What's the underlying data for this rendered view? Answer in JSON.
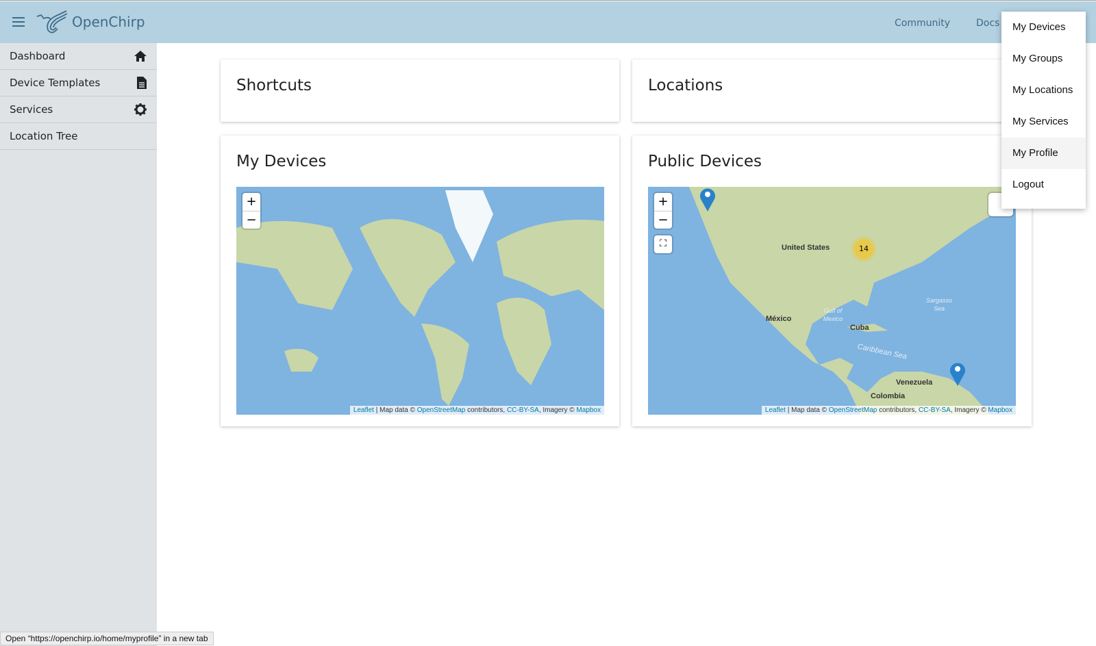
{
  "header": {
    "brand": "OpenChirp",
    "nav": [
      "Community",
      "Docs"
    ]
  },
  "sidebar": {
    "items": [
      {
        "label": "Dashboard",
        "icon": "home-icon"
      },
      {
        "label": "Device Templates",
        "icon": "document-icon"
      },
      {
        "label": "Services",
        "icon": "gear-icon"
      },
      {
        "label": "Location Tree",
        "icon": ""
      }
    ]
  },
  "cards": {
    "shortcuts": "Shortcuts",
    "locations": "Locations",
    "my_devices": "My Devices",
    "public_devices": "Public Devices"
  },
  "map": {
    "zoom_in": "+",
    "zoom_out": "−",
    "attribution": {
      "leaflet": "Leaflet",
      "sep": " | Map data © ",
      "osm": "OpenStreetMap",
      "contrib": " contributors, ",
      "license": "CC-BY-SA",
      "imagery": ", Imagery © ",
      "mapbox": "Mapbox"
    },
    "public_labels": {
      "us": "United States",
      "mexico": "México",
      "cuba": "Cuba",
      "venezuela": "Venezuela",
      "colombia": "Colombia",
      "gulf": "Gulf of Mexico",
      "caribbean": "Caribbean Sea",
      "sargasso": "Sargasso Sea"
    },
    "cluster_count": "14"
  },
  "user_menu": {
    "items": [
      "My Devices",
      "My Groups",
      "My Locations",
      "My Services",
      "My Profile",
      "Logout"
    ],
    "highlighted": "My Profile"
  },
  "status_bar": "Open “https://openchirp.io/home/myprofile” in a new tab",
  "colors": {
    "header": "#b3d1e0",
    "sidebar": "#dfe3e6",
    "water": "#7fb3e0",
    "land": "#c9d6a8",
    "cluster": "#e8c94a",
    "marker": "#2a81cb"
  }
}
